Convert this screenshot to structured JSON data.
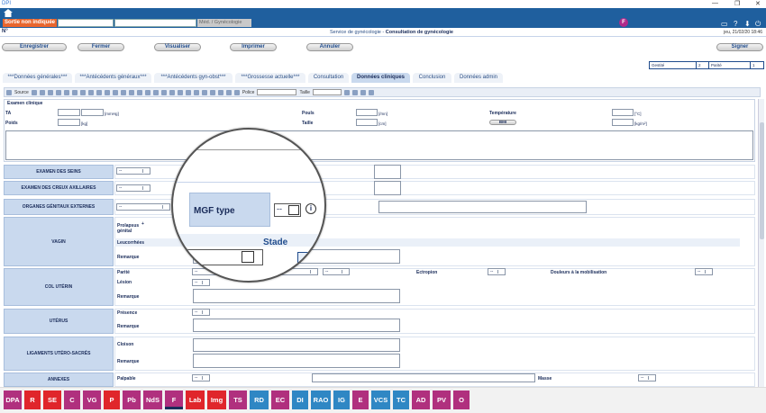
{
  "app": {
    "title": "DPI"
  },
  "window": {
    "controls": [
      "—",
      "❐",
      "✕"
    ]
  },
  "header": {
    "patient_name": "Sortie non indiquée",
    "module": "Méd. / Gynécologie",
    "badge": "F"
  },
  "info": {
    "number_label": "N°",
    "service": "Service de gynécologie - ",
    "consultation": "Consultation de gynécologie",
    "date": "jeu, 21/02/20 18:46"
  },
  "actions": {
    "save": "Enregistrer",
    "close": "Fermer",
    "view": "Visualiser",
    "print": "Imprimer",
    "cancel": "Annuler",
    "sign": "Signer"
  },
  "status": {
    "gestite_label": "Gestité",
    "gestite_value": "2",
    "parite_label": "Parité",
    "parite_value": "1"
  },
  "tabs": [
    "***Données générales***",
    "***Antécédents généraux***",
    "***Antécédents gyn-obst***",
    "***Grossesse actuelle***",
    "Consultation",
    "Données cliniques",
    "Conclusion",
    "Données admin"
  ],
  "toolbar": {
    "source": "Source",
    "font": "Police",
    "size": "Taille"
  },
  "exam": {
    "title": "Examen clinique",
    "ta": "TA",
    "ta_unit": "[mmHg]",
    "pouls": "Pouls",
    "pouls_unit": "[/mn]",
    "temp": "Température",
    "temp_unit": "[°C]",
    "poids": "Poids",
    "poids_unit": "[kg]",
    "taille": "Taille",
    "taille_unit": "[cm]",
    "bmi": "BMI",
    "bmi_unit": "[kg/m²]"
  },
  "rows": {
    "seins": "EXAMEN DES SEINS",
    "creux": "EXAMEN DES CREUX AXILLAIRES",
    "organes": "ORGANES GÉNITAUX EXTERNES",
    "vagin": "VAGIN",
    "col": "COL UTÉRIN",
    "uterus": "UTÉRUS",
    "ligaments": "LIGAMENTS UTÉRO-SACRÉS",
    "annexes": "ANNEXES"
  },
  "sub": {
    "prolapsus": "Prolapsus génital",
    "leucorrhees": "Leucorrhées",
    "remarque": "Remarque",
    "parite": "Parité",
    "ectropion": "Ectropion",
    "douleurs": "Douleurs à la mobilisation",
    "lesion": "Lésion",
    "presence": "Présence",
    "cloison": "Cloison",
    "palpable": "Palpable",
    "masse": "Masse"
  },
  "select_default": "--",
  "magnifier": {
    "mgf_type": "MGF type",
    "select": "--",
    "info": "i",
    "stade": "Stade"
  },
  "bottom_tabs": [
    {
      "label": "DPA",
      "color": "#b0307e"
    },
    {
      "label": "R",
      "color": "#e0262b"
    },
    {
      "label": "SE",
      "color": "#e0262b"
    },
    {
      "label": "C",
      "color": "#b0307e"
    },
    {
      "label": "VG",
      "color": "#b0307e"
    },
    {
      "label": "P",
      "color": "#e0262b"
    },
    {
      "label": "Pb",
      "color": "#b0307e"
    },
    {
      "label": "NdS",
      "color": "#b0307e"
    },
    {
      "label": "F",
      "color": "#b0307e"
    },
    {
      "label": "Lab",
      "color": "#e0262b"
    },
    {
      "label": "Img",
      "color": "#e0262b"
    },
    {
      "label": "TS",
      "color": "#b0307e"
    },
    {
      "label": "RD",
      "color": "#2f87c4"
    },
    {
      "label": "EC",
      "color": "#b0307e"
    },
    {
      "label": "DI",
      "color": "#2f87c4"
    },
    {
      "label": "RAO",
      "color": "#2f87c4"
    },
    {
      "label": "IG",
      "color": "#2f87c4"
    },
    {
      "label": "E",
      "color": "#b0307e"
    },
    {
      "label": "VCS",
      "color": "#2f87c4"
    },
    {
      "label": "TC",
      "color": "#2f87c4"
    },
    {
      "label": "AD",
      "color": "#b0307e"
    },
    {
      "label": "PV",
      "color": "#b0307e"
    },
    {
      "label": "O",
      "color": "#b0307e"
    }
  ]
}
